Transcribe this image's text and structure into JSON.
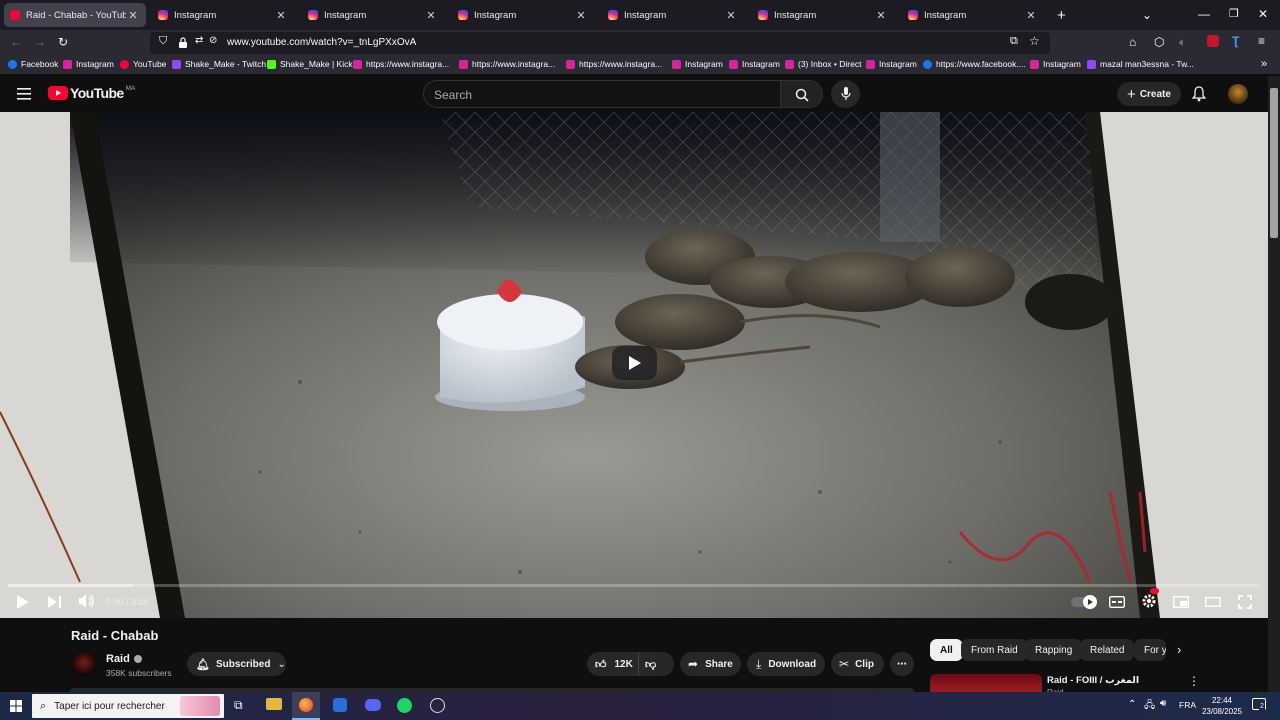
{
  "tabs": [
    {
      "title": "Raid - Chabab - YouTube",
      "favicon": "youtube",
      "active": true
    },
    {
      "title": "Instagram",
      "favicon": "instagram",
      "active": false
    },
    {
      "title": "Instagram",
      "favicon": "instagram",
      "active": false
    },
    {
      "title": "Instagram",
      "favicon": "instagram",
      "active": false
    },
    {
      "title": "Instagram",
      "favicon": "instagram",
      "active": false
    },
    {
      "title": "Instagram",
      "favicon": "instagram",
      "active": false
    },
    {
      "title": "Instagram",
      "favicon": "instagram",
      "active": false
    }
  ],
  "tab_close_glyph": "✕",
  "url": "www.youtube.com/watch?v=_tnLgPXxOvA",
  "bookmarks": [
    {
      "label": "Facebook",
      "icon": "facebook"
    },
    {
      "label": "Instagram",
      "icon": "instagram"
    },
    {
      "label": "YouTube",
      "icon": "youtube"
    },
    {
      "label": "Shake_Make - Twitch",
      "icon": "twitch"
    },
    {
      "label": "Shake_Make | Kick",
      "icon": "kick"
    },
    {
      "label": "https://www.instagra...",
      "icon": "instagram"
    },
    {
      "label": "https://www.instagra...",
      "icon": "instagram"
    },
    {
      "label": "https://www.instagra...",
      "icon": "instagram"
    },
    {
      "label": "Instagram",
      "icon": "instagram"
    },
    {
      "label": "Instagram",
      "icon": "instagram"
    },
    {
      "label": "(3) Inbox • Direct",
      "icon": "instagram"
    },
    {
      "label": "Instagram",
      "icon": "instagram"
    },
    {
      "label": "https://www.facebook....",
      "icon": "facebook"
    },
    {
      "label": "Instagram",
      "icon": "instagram"
    },
    {
      "label": "mazal man3essna - Tw...",
      "icon": "twitch"
    }
  ],
  "youtube": {
    "logo_text": "YouTube",
    "region_code": "MA",
    "search_placeholder": "Search",
    "create_label": "Create"
  },
  "player": {
    "time": "0:00 / 3:44",
    "progress_fraction": 0.0,
    "buffered_fraction": 0.1
  },
  "video": {
    "title": "Raid - Chabab",
    "channel": "Raid",
    "subscribers": "358K subscribers",
    "subscribed_label": "Subscribed",
    "likes": "12K",
    "share_label": "Share",
    "download_label": "Download",
    "clip_label": "Clip"
  },
  "chips": [
    "All",
    "From Raid",
    "Rapping",
    "Related",
    "For y"
  ],
  "recommendation": {
    "title": "Raid - FOIII / المغرب",
    "channel": "Raid"
  },
  "taskbar": {
    "search_placeholder": "Taper ici pour rechercher",
    "language": "FRA",
    "time": "22:44",
    "date": "23/08/2025",
    "notifications": "2"
  },
  "colors": {
    "youtube_red": "#ff0033",
    "player_progress": "#ff0033",
    "background": "#0f0f0f"
  }
}
